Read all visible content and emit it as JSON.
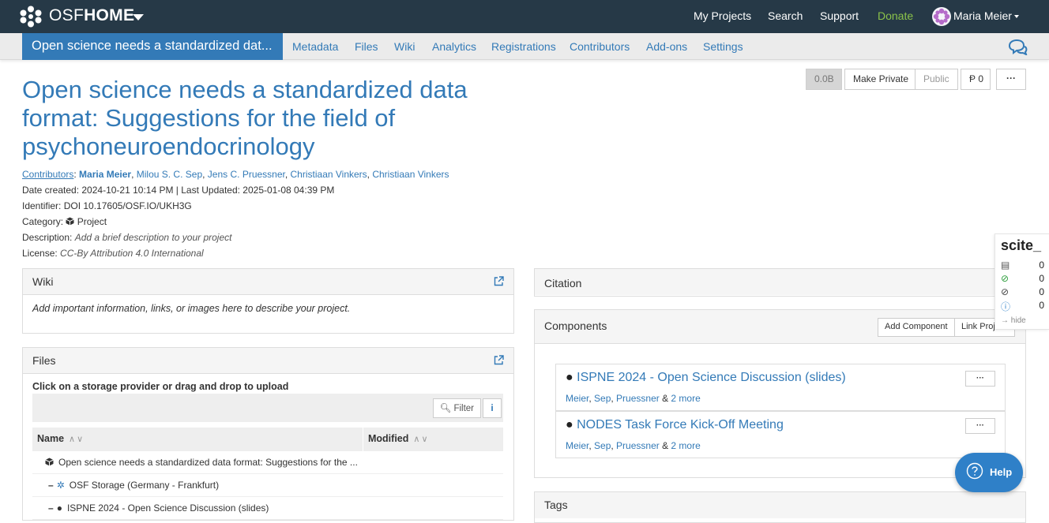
{
  "topbar": {
    "brand_thin": "OSF",
    "brand_bold": "HOME",
    "links": [
      "My Projects",
      "Search",
      "Support",
      "Donate"
    ],
    "user_name": "Maria Meier"
  },
  "projnav": {
    "title_short": "Open science needs a standardized dat...",
    "tabs": [
      "Metadata",
      "Files",
      "Wiki",
      "Analytics",
      "Registrations",
      "Contributors",
      "Add-ons",
      "Settings"
    ]
  },
  "project": {
    "title": "Open science needs a standardized data format: Suggestions for the field of psychoneuroendocrinology",
    "contributors_label": "Contributors",
    "contributors": [
      "Maria Meier",
      "Milou S. C. Sep",
      "Jens C. Pruessner",
      "Christiaan Vinkers",
      "Christiaan Vinkers"
    ],
    "date_line": "Date created: 2024-10-21 10:14 PM | Last Updated: 2025-01-08 04:39 PM",
    "identifier_line": "Identifier: DOI 10.17605/OSF.IO/UKH3G",
    "category_label": "Category:",
    "category_value": "Project",
    "description_label": "Description:",
    "description_value": "Add a brief description to your project",
    "license_label": "License:",
    "license_value": "CC-By Attribution 4.0 International"
  },
  "actions": {
    "size": "0.0B",
    "make_private": "Make Private",
    "public": "Public",
    "forks": "0",
    "more": "···"
  },
  "wiki": {
    "heading": "Wiki",
    "body": "Add important information, links, or images here to describe your project."
  },
  "files": {
    "heading": "Files",
    "instruction": "Click on a storage provider or drag and drop to upload",
    "filter_label": "Filter",
    "info_label": "i",
    "col_name": "Name",
    "col_modified": "Modified",
    "rows": [
      "Open science needs a standardized data format: Suggestions for the ...",
      "OSF Storage (Germany - Frankfurt)",
      "ISPNE 2024 - Open Science Discussion (slides)"
    ]
  },
  "citation": {
    "heading": "Citation"
  },
  "components": {
    "heading": "Components",
    "add_component": "Add Component",
    "link_projects": "Link Projects",
    "items": [
      {
        "title": "ISPNE 2024 - Open Science Discussion (slides)",
        "authors": [
          "Meier",
          "Sep",
          "Pruessner"
        ],
        "more": "2 more"
      },
      {
        "title": "NODES Task Force Kick-Off Meeting",
        "authors": [
          "Meier",
          "Sep",
          "Pruessner"
        ],
        "more": "2 more"
      }
    ]
  },
  "tags": {
    "heading": "Tags"
  },
  "scite": {
    "title": "scite_",
    "counts": [
      "0",
      "0",
      "0",
      "0"
    ],
    "hide_label": "hide"
  },
  "help": {
    "label": "Help"
  },
  "colors": {
    "navbar": "#263947",
    "accent": "#337ab7",
    "donate": "#8bc34a"
  }
}
